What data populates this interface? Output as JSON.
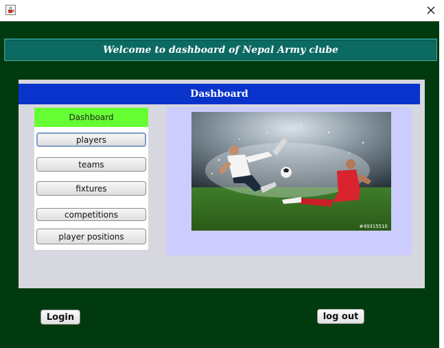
{
  "window": {
    "icon": "java-cup-icon",
    "close_glyph": "✕"
  },
  "welcome": {
    "text": "Welcome to dashboard of Nepal Army clube"
  },
  "panel": {
    "header": "Dashboard"
  },
  "nav": {
    "title": "Dashboard",
    "title_color": "#66ff33",
    "items": [
      {
        "label": "players"
      },
      {
        "label": "teams"
      },
      {
        "label": "fixtures"
      },
      {
        "label": "competitions"
      },
      {
        "label": "player positions"
      }
    ]
  },
  "image": {
    "description_icon": "soccer-players-photo",
    "stock_id": "#49315510"
  },
  "footer": {
    "login_label": "Login",
    "logout_label": "log out"
  },
  "colors": {
    "background": "#003a0e",
    "banner": "#0b6a61",
    "header": "#0a33cc",
    "image_panel": "#ccccff"
  }
}
